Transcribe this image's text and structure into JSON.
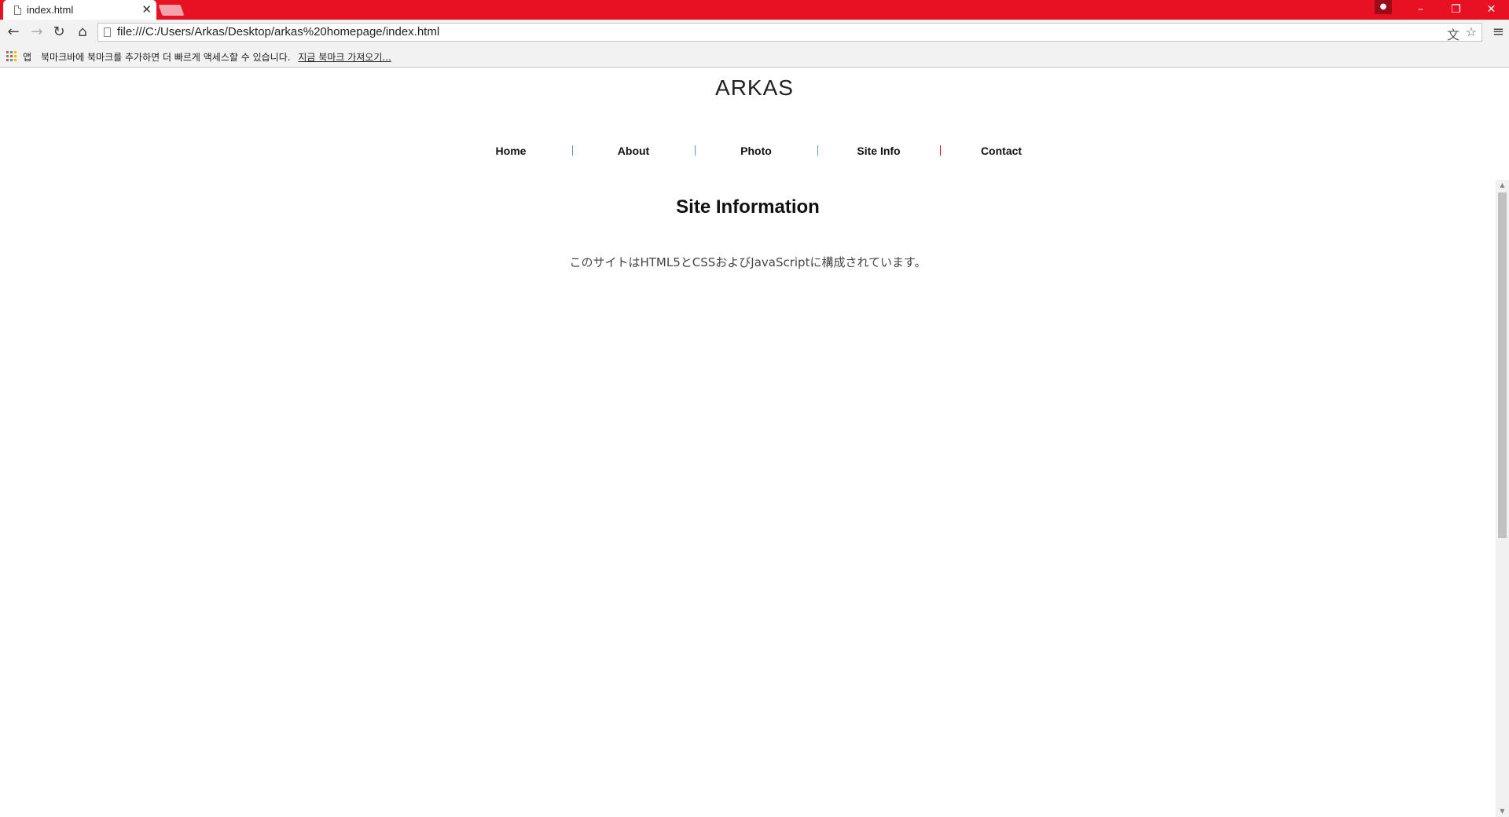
{
  "browser": {
    "tab_title": "index.html",
    "tab_close": "✕",
    "url": "file:///C:/Users/Arkas/Desktop/arkas%20homepage/index.html",
    "window": {
      "minimize": "–",
      "restore": "❐",
      "close": "✕"
    },
    "nav": {
      "back": "←",
      "forward": "→",
      "reload": "↻",
      "home": "⌂"
    },
    "omnibox_icons": {
      "translate": "文",
      "star": "☆"
    },
    "menu": "≡"
  },
  "bookmarks_bar": {
    "apps_label": "앱",
    "message": "북마크바에 북마크를 추가하면 더 빠르게 액세스할 수 있습니다.",
    "import_link": "지금 북마크 가져오기..."
  },
  "site": {
    "logo": "ARKAS",
    "nav": [
      "Home",
      "About",
      "Photo",
      "Site Info",
      "Contact"
    ],
    "separator": "|",
    "separator_colors": [
      "#5aa0b4",
      "#5aa0b4",
      "#5aa0b4",
      "#e81123"
    ],
    "heading": "Site Information",
    "body_text": "このサイトはHTML5とCSSおよびJavaScriptに構成されています。"
  },
  "colors": {
    "titlebar": "#e81123",
    "toolbar": "#f2f2f2"
  }
}
